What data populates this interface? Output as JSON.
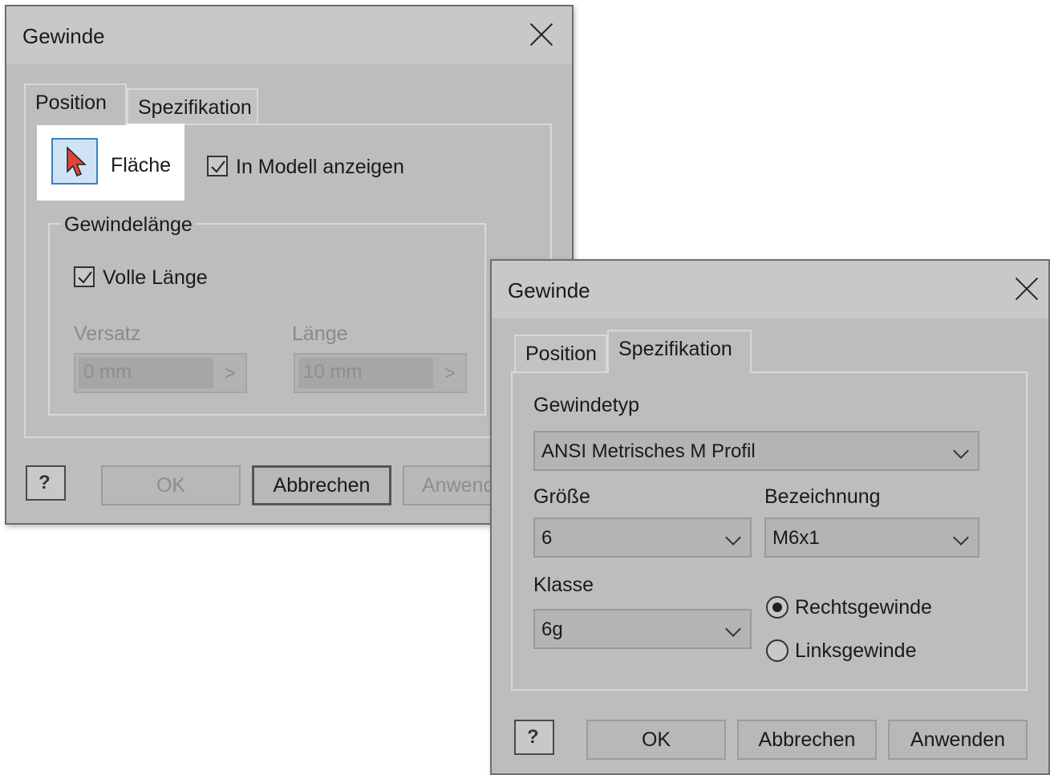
{
  "dialog1": {
    "title": "Gewinde",
    "tabs": [
      "Position",
      "Spezifikation"
    ],
    "active_tab": "Position",
    "face_label": "Fläche",
    "show_in_model_label": "In Modell anzeigen",
    "show_in_model_checked": true,
    "group_title": "Gewindelänge",
    "full_length_label": "Volle Länge",
    "full_length_checked": true,
    "offset_label": "Versatz",
    "offset_value": "0 mm",
    "length_label": "Länge",
    "length_value": "10 mm",
    "field_arrow": ">",
    "help": "?",
    "buttons": {
      "ok": "OK",
      "cancel": "Abbrechen",
      "apply": "Anwend"
    }
  },
  "dialog2": {
    "title": "Gewinde",
    "tabs": [
      "Position",
      "Spezifikation"
    ],
    "active_tab": "Spezifikation",
    "thread_type_label": "Gewindetyp",
    "thread_type_value": "ANSI Metrisches M Profil",
    "size_label": "Größe",
    "size_value": "6",
    "designation_label": "Bezeichnung",
    "designation_value": "M6x1",
    "class_label": "Klasse",
    "class_value": "6g",
    "right_hand_label": "Rechtsgewinde",
    "left_hand_label": "Linksgewinde",
    "selected_direction": "Rechtsgewinde",
    "help": "?",
    "buttons": {
      "ok": "OK",
      "cancel": "Abbrechen",
      "apply": "Anwenden"
    }
  }
}
